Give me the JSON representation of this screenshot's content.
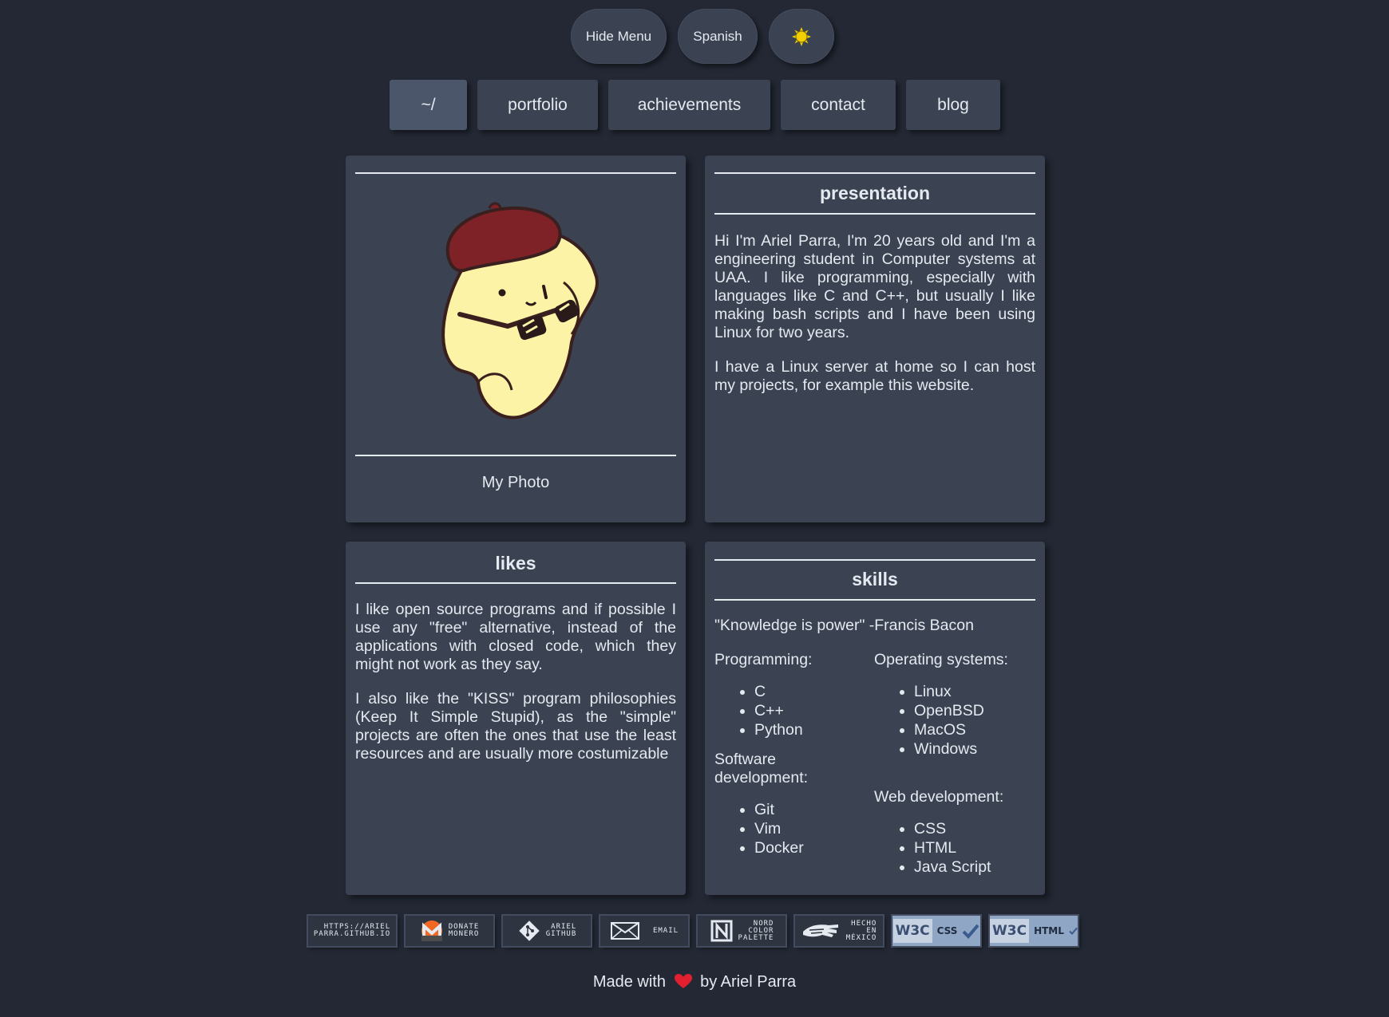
{
  "top_buttons": {
    "hide_menu": "Hide Menu",
    "language": "Spanish",
    "theme_icon": "sun-icon"
  },
  "nav": {
    "items": [
      {
        "label": "~/",
        "active": true
      },
      {
        "label": "portfolio"
      },
      {
        "label": "achievements"
      },
      {
        "label": "contact"
      },
      {
        "label": "blog"
      }
    ]
  },
  "photo_card": {
    "caption": "My Photo",
    "image": "pompompurin-with-beret-and-glasses"
  },
  "presentation": {
    "title": "presentation",
    "paragraphs": [
      "Hi I'm Ariel Parra, I'm 20 years old and I'm a engineering student in Computer systems at UAA. I like programming, especially with languages like C and C++, but usually I like making bash scripts and I have been using Linux for two years.",
      "I have a Linux server at home so I can host my projects, for example this website."
    ]
  },
  "likes": {
    "title": "likes",
    "paragraphs": [
      "I like open source programs and if possible I use any \"free\" alternative, instead of the applications with closed code, which they might not work as they say.",
      "I also like the \"KISS\" program philosophies (Keep It Simple Stupid), as the \"simple\" projects are often the ones that use the least resources and are usually more costumizable"
    ]
  },
  "skills": {
    "title": "skills",
    "quote": "\"Knowledge is power\" -Francis Bacon",
    "programming": {
      "label": "Programming:",
      "items": [
        "C",
        "C++",
        "Python"
      ]
    },
    "operating_systems": {
      "label": "Operating systems:",
      "items": [
        "Linux",
        "OpenBSD",
        "MacOS",
        "Windows"
      ]
    },
    "software_development": {
      "label": "Software development:",
      "items": [
        "Git",
        "Vim",
        "Docker"
      ]
    },
    "web_development": {
      "label": "Web development:",
      "items": [
        "CSS",
        "HTML",
        "Java Script"
      ]
    }
  },
  "badges": {
    "site": "HTTPS://ARIEL\nPARRA.GITHUB.IO",
    "monero": "DONATE\nMONERO",
    "github": "ARIEL\nGITHUB",
    "email": "EMAIL",
    "nord": "NORD\nCOLOR\nPALETTE",
    "mexico": "HECHO\nEN\nMÉXICO",
    "w3c": "W3C",
    "css": "CSS",
    "html": "HTML"
  },
  "footer": {
    "made_with": "Made with",
    "by": "by Ariel Parra"
  },
  "colors": {
    "background": "#232834",
    "card": "#3b4252",
    "text": "#e5e9f0",
    "heart": "#e0202f",
    "sun": "#f2d000"
  }
}
